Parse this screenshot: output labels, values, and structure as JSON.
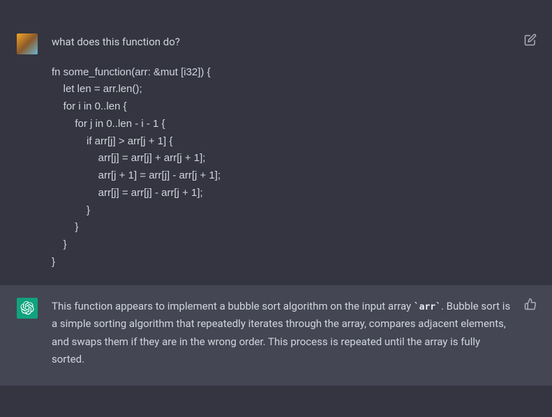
{
  "user_message": {
    "question": "what does this function do?",
    "code": "fn some_function(arr: &mut [i32]) {\n    let len = arr.len();\n    for i in 0..len {\n        for j in 0..len - i - 1 {\n            if arr[j] > arr[j + 1] {\n                arr[j] = arr[j] + arr[j + 1];\n                arr[j + 1] = arr[j] - arr[j + 1];\n                arr[j] = arr[j] - arr[j + 1];\n            }\n        }\n    }\n}"
  },
  "assistant_message": {
    "text_before_code": "This function appears to implement a bubble sort algorithm on the input array ",
    "inline_code": "`arr`",
    "text_after_code": ". Bubble sort is a simple sorting algorithm that repeatedly iterates through the array, compares adjacent elements, and swaps them if they are in the wrong order. This process is repeated until the array is fully sorted."
  }
}
